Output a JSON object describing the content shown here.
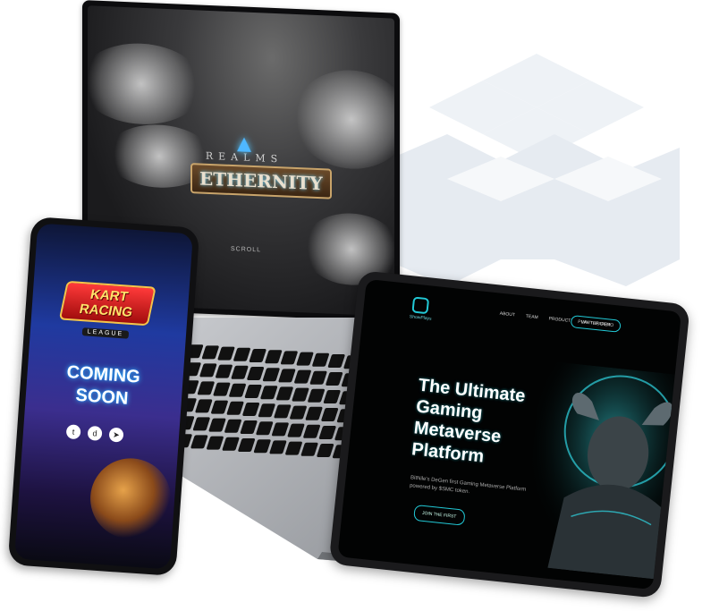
{
  "laptop": {
    "game_logo_top": "REALMS",
    "game_logo_main": "ETHERNITY",
    "scroll_hint": "SCROLL"
  },
  "phone": {
    "logo_main": "KART RACING",
    "logo_sub": "LEAGUE",
    "headline_line1": "COMING",
    "headline_line2": "SOON",
    "social_icons": [
      "twitter-icon",
      "discord-icon",
      "telegram-icon"
    ]
  },
  "tablet": {
    "brand_name": "ShowPlays",
    "nav": [
      "ABOUT",
      "TEAM",
      "PRODUCT",
      "WHITEPAPER"
    ],
    "nav_cta": "PLAY THE DEMO",
    "headline": [
      "The Ultimate",
      "Gaming",
      "Metaverse",
      "Platform"
    ],
    "description": "BitNile's DeGen first Gaming Metaverse Platform powered by $SMC token.",
    "cta_button": "JOIN THE FIRST"
  },
  "colors": {
    "accent_cyan": "#22c9d6",
    "realms_gem": "#4fb7ff",
    "kart_red": "#e02020"
  }
}
